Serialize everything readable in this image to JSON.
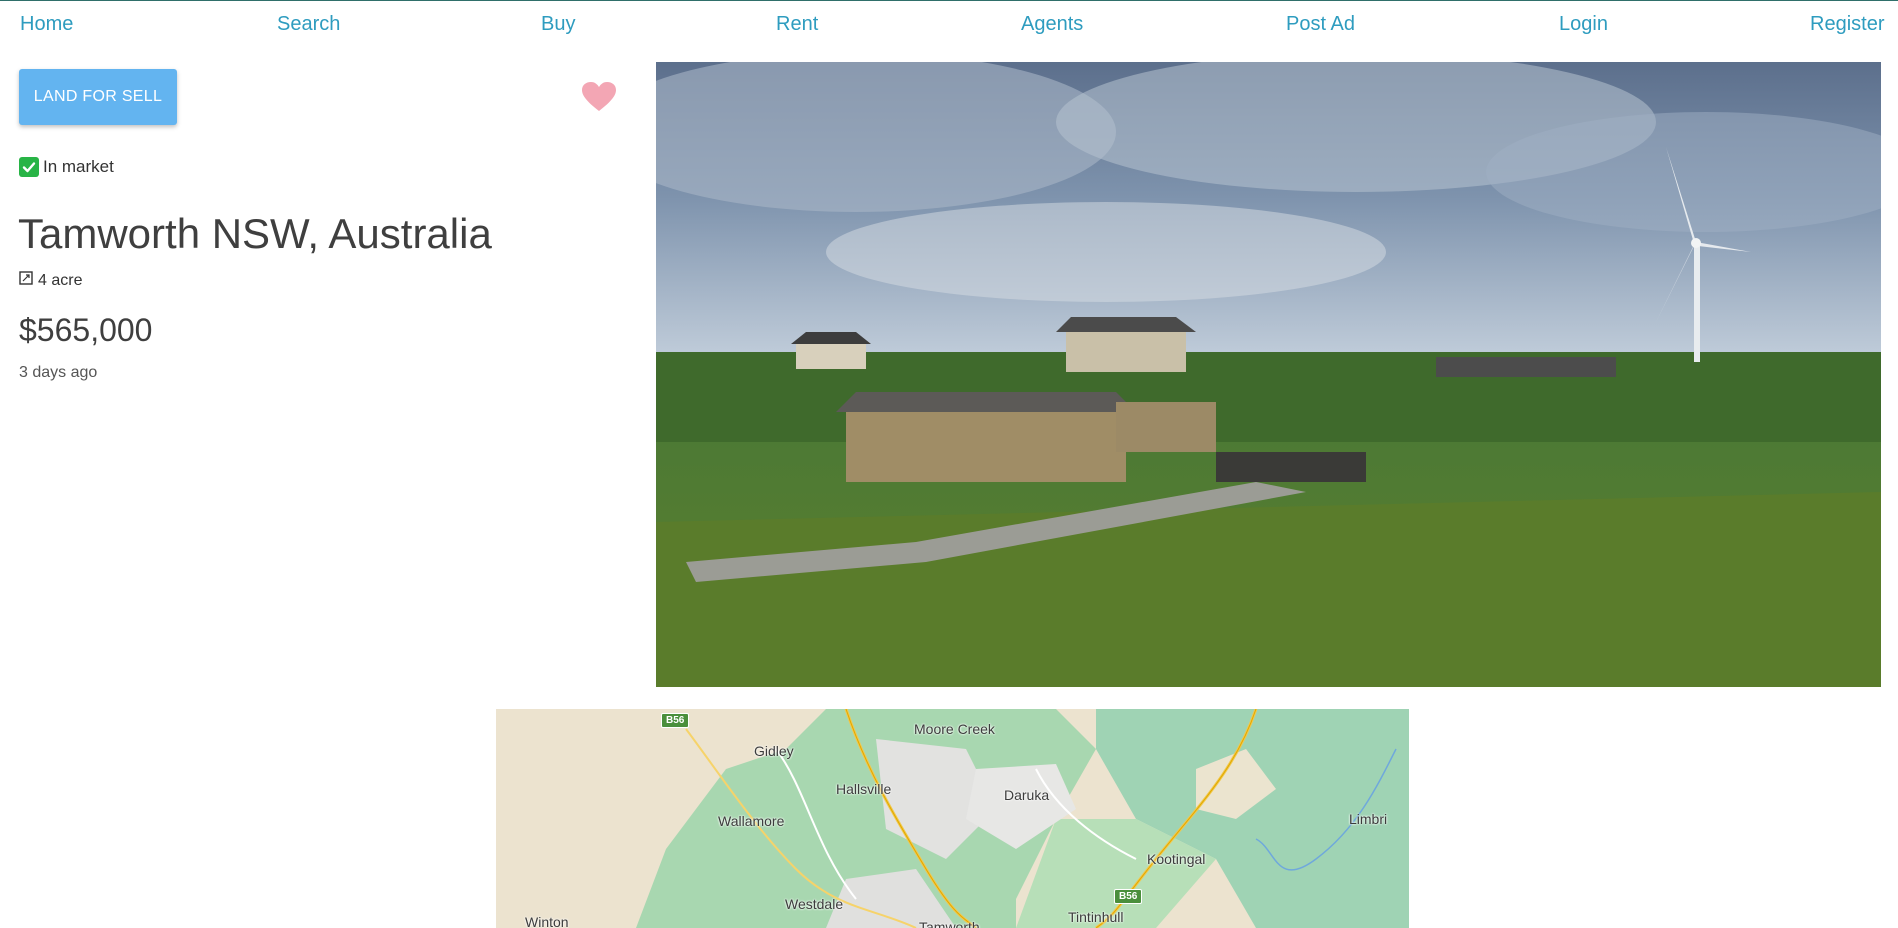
{
  "nav": {
    "home": "Home",
    "search": "Search",
    "buy": "Buy",
    "rent": "Rent",
    "agents": "Agents",
    "post_ad": "Post Ad",
    "login": "Login",
    "register": "Register"
  },
  "listing": {
    "category_badge": "LAND FOR SELL",
    "status": "In market",
    "title": "Tamworth NSW, Australia",
    "area": "4 acre",
    "price": "$565,000",
    "posted": "3 days ago",
    "favorite_icon": "heart-icon",
    "status_icon": "check-mark-icon",
    "area_icon": "area-icon"
  },
  "map": {
    "labels": {
      "moore_creek": "Moore Creek",
      "gidley": "Gidley",
      "hallsville": "Hallsville",
      "daruka": "Daruka",
      "wallamore": "Wallamore",
      "limbri": "Limbri",
      "kootingal": "Kootingal",
      "westdale": "Westdale",
      "winton": "Winton",
      "tamworth": "Tamworth",
      "tintinhull": "Tintinhull"
    },
    "route_shields": {
      "b56_north": "B56",
      "b56_east": "B56"
    }
  },
  "colors": {
    "nav_link": "#2e9cbf",
    "badge_bg": "#63b4f0",
    "heart": "#f3a6b4",
    "status_check": "#28b446"
  }
}
